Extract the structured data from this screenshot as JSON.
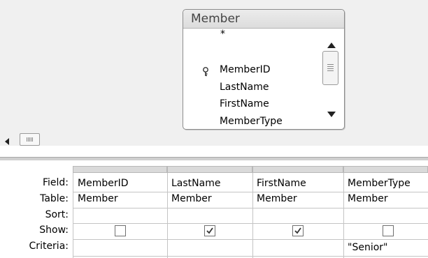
{
  "table": {
    "title": "Member",
    "fields": [
      "*",
      "MemberID",
      "LastName",
      "FirstName",
      "MemberType"
    ],
    "primary_key_field": "MemberID"
  },
  "grid": {
    "row_labels": {
      "field": "Field:",
      "table": "Table:",
      "sort": "Sort:",
      "show": "Show:",
      "criteria": "Criteria:"
    },
    "columns": [
      {
        "field": "MemberID",
        "table": "Member",
        "sort": "",
        "show": false,
        "criteria": ""
      },
      {
        "field": "LastName",
        "table": "Member",
        "sort": "",
        "show": true,
        "criteria": ""
      },
      {
        "field": "FirstName",
        "table": "Member",
        "sort": "",
        "show": true,
        "criteria": ""
      },
      {
        "field": "MemberType",
        "table": "Member",
        "sort": "",
        "show": false,
        "criteria": "\"Senior\""
      }
    ]
  },
  "icons": {
    "key": "key-icon",
    "scroll_up": "arrow-up-icon",
    "scroll_down": "arrow-down-icon",
    "scroll_left": "arrow-left-icon",
    "checkmark": "checkmark-icon"
  }
}
